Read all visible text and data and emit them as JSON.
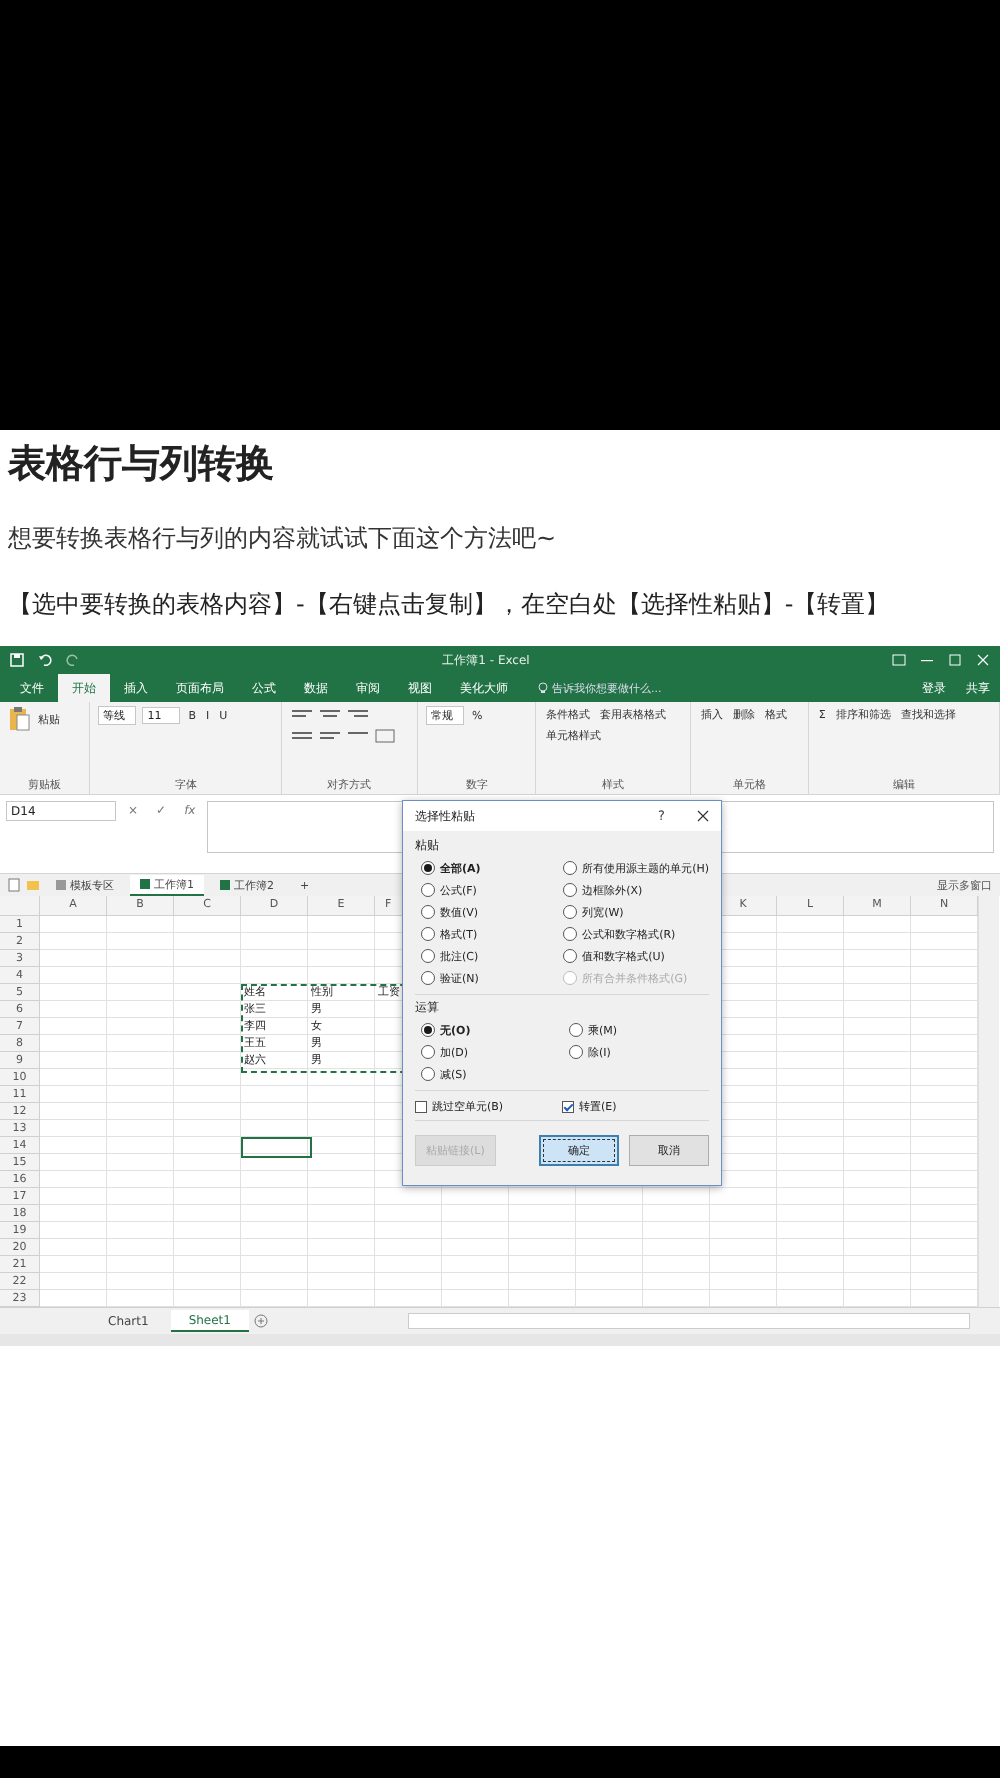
{
  "article": {
    "title": "表格行与列转换",
    "intro": "想要转换表格行与列的内容就试试下面这个方法吧~",
    "steps": "【选中要转换的表格内容】-【右键点击复制】，在空白处【选择性粘贴】-【转置】"
  },
  "excel": {
    "title": "工作簿1 - Excel",
    "ribbon_tabs": [
      {
        "label": "文件",
        "selected": false
      },
      {
        "label": "开始",
        "selected": true
      },
      {
        "label": "插入",
        "selected": false
      },
      {
        "label": "页面布局",
        "selected": false
      },
      {
        "label": "公式",
        "selected": false
      },
      {
        "label": "数据",
        "selected": false
      },
      {
        "label": "审阅",
        "selected": false
      },
      {
        "label": "视图",
        "selected": false
      },
      {
        "label": "美化大师",
        "selected": false
      }
    ],
    "tell_me": "告诉我你想要做什么...",
    "sign_in": "登录",
    "share": "共享",
    "ribbon_groups": [
      {
        "label": "剪贴板",
        "items": [
          "粘贴"
        ]
      },
      {
        "label": "字体",
        "fields": [
          "等线",
          "11"
        ],
        "items": [
          "B",
          "I",
          "U"
        ]
      },
      {
        "label": "对齐方式"
      },
      {
        "label": "数字",
        "fields": [
          "常规"
        ],
        "items": [
          "%"
        ]
      },
      {
        "label": "样式",
        "items": [
          "条件格式",
          "套用表格格式",
          "单元格样式"
        ]
      },
      {
        "label": "单元格",
        "items": [
          "插入",
          "删除",
          "格式"
        ]
      },
      {
        "label": "编辑",
        "items": [
          "Σ",
          "排序和筛选",
          "查找和选择"
        ]
      }
    ],
    "name_box": "D14",
    "formula_buttons": [
      "×",
      "✓",
      "fx"
    ],
    "workbook_tabs": [
      {
        "label": "模板专区",
        "selected": false
      },
      {
        "label": "工作簿1",
        "selected": true
      },
      {
        "label": "工作簿2",
        "selected": false
      }
    ],
    "new_tab": "+",
    "multi_window": "显示多窗口",
    "columns_left": [
      "A",
      "B",
      "C",
      "D",
      "E",
      "F"
    ],
    "columns_right": [
      "K",
      "L",
      "M",
      "N"
    ],
    "rows": [
      "1",
      "2",
      "3",
      "4",
      "5",
      "6",
      "7",
      "8",
      "9",
      "10",
      "11",
      "12",
      "13",
      "14",
      "15",
      "16",
      "17",
      "18",
      "19",
      "20",
      "21",
      "22",
      "23"
    ],
    "selection_rows": [
      [
        "姓名",
        "性别",
        "工资"
      ],
      [
        "张三",
        "男"
      ],
      [
        "李四",
        "女"
      ],
      [
        "王五",
        "男"
      ],
      [
        "赵六",
        "男"
      ]
    ],
    "sheet_tabs": [
      {
        "label": "Chart1",
        "selected": false
      },
      {
        "label": "Sheet1",
        "selected": true
      }
    ]
  },
  "dialog": {
    "title": "选择性粘贴",
    "help": "?",
    "paste_label": "粘贴",
    "paste_options": [
      {
        "label": "全部(A)",
        "selected": true,
        "disabled": false
      },
      {
        "label": "公式(F)",
        "selected": false,
        "disabled": false
      },
      {
        "label": "数值(V)",
        "selected": false,
        "disabled": false
      },
      {
        "label": "格式(T)",
        "selected": false,
        "disabled": false
      },
      {
        "label": "批注(C)",
        "selected": false,
        "disabled": false
      },
      {
        "label": "验证(N)",
        "selected": false,
        "disabled": false
      },
      {
        "label": "所有使用源主题的单元(H)",
        "selected": false,
        "disabled": false
      },
      {
        "label": "边框除外(X)",
        "selected": false,
        "disabled": false
      },
      {
        "label": "列宽(W)",
        "selected": false,
        "disabled": false
      },
      {
        "label": "公式和数字格式(R)",
        "selected": false,
        "disabled": false
      },
      {
        "label": "值和数字格式(U)",
        "selected": false,
        "disabled": false
      },
      {
        "label": "所有合并条件格式(G)",
        "selected": false,
        "disabled": true
      }
    ],
    "operation_label": "运算",
    "operations": [
      {
        "label": "无(O)",
        "selected": true
      },
      {
        "label": "加(D)",
        "selected": false
      },
      {
        "label": "减(S)",
        "selected": false
      },
      {
        "label": "乘(M)",
        "selected": false
      },
      {
        "label": "除(I)",
        "selected": false
      }
    ],
    "checkboxes": [
      {
        "label": "跳过空单元(B)",
        "checked": false
      },
      {
        "label": "转置(E)",
        "checked": true
      }
    ],
    "buttons": [
      {
        "label": "粘贴链接(L)",
        "disabled": true,
        "default": false
      },
      {
        "label": "确定",
        "disabled": false,
        "default": true
      },
      {
        "label": "取消",
        "disabled": false,
        "default": false
      }
    ]
  }
}
